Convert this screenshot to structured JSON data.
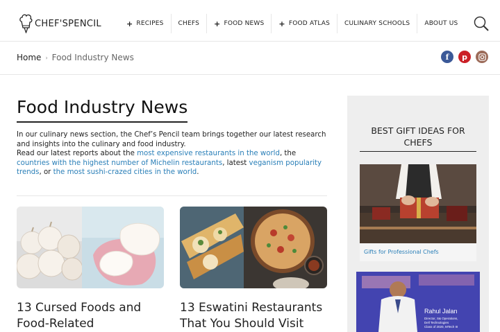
{
  "header": {
    "logo_text": "CHEF'SPENCIL",
    "nav": [
      {
        "label": "RECIPES",
        "plus": true
      },
      {
        "label": "CHEFS",
        "plus": false
      },
      {
        "label": "FOOD NEWS",
        "plus": true
      },
      {
        "label": "FOOD ATLAS",
        "plus": true
      },
      {
        "label": "CULINARY SCHOOLS",
        "plus": false
      },
      {
        "label": "ABOUT US",
        "plus": false
      }
    ],
    "plus_glyph": "+"
  },
  "breadcrumb": {
    "home": "Home",
    "separator": "›",
    "current": "Food Industry News"
  },
  "social": {
    "facebook": "f",
    "pinterest": "p",
    "instagram": "◎",
    "colors": {
      "facebook": "#3b5998",
      "pinterest": "#cb2027",
      "instagram": "#9c6b59"
    }
  },
  "main": {
    "title": "Food Industry News",
    "intro": {
      "p1": "In our culinary news section, the Chef’s Pencil team brings together our latest research and insights into the culinary and food industry.",
      "p2_start": "Read our latest reports about the ",
      "link1": "most expensive restaurants in the world",
      "p2_mid1": ", the ",
      "link2": "countries with the highest number of Michelin restaurants",
      "p2_mid2": ", latest ",
      "link3": "veganism popularity trends",
      "p2_mid3": ", or ",
      "link4": "the most sushi-crazed cities in the world",
      "p2_end": "."
    },
    "articles": [
      {
        "title": "13 Cursed Foods and Food-Related"
      },
      {
        "title": "13 Eswatini Restaurants That You Should Visit"
      }
    ]
  },
  "sidebar": {
    "heading": "BEST GIFT IDEAS FOR CHEFS",
    "gift_caption": "Gifts for Professional Chefs",
    "ad": {
      "name": "Rahul Jalan",
      "line1": "Director, S& Operations,",
      "line2": "Dell Technologies",
      "line3": "Class of 2020, MTech III"
    }
  },
  "colors": {
    "link": "#2a7fb8",
    "sidebar_bg": "#eeeeee"
  }
}
